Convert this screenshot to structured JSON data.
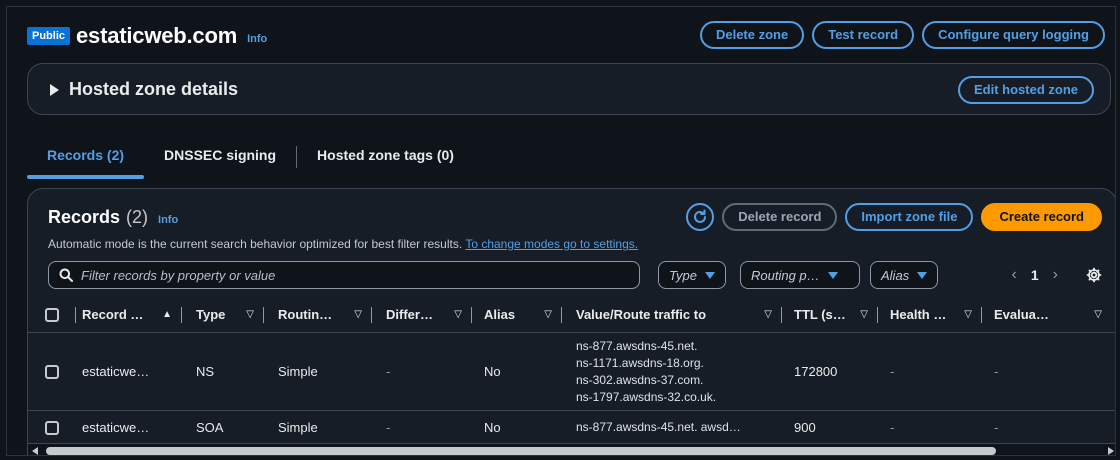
{
  "header": {
    "badge": "Public",
    "title": "estaticweb.com",
    "info": "Info",
    "actions": {
      "delete_zone": "Delete zone",
      "test_record": "Test record",
      "configure_logging": "Configure query logging"
    }
  },
  "details": {
    "title": "Hosted zone details",
    "edit_button": "Edit hosted zone"
  },
  "tabs": [
    {
      "label": "Records (2)",
      "active": true
    },
    {
      "label": "DNSSEC signing",
      "active": false
    },
    {
      "label": "Hosted zone tags (0)",
      "active": false
    }
  ],
  "records": {
    "title": "Records",
    "count": "(2)",
    "info": "Info",
    "delete_button": "Delete record",
    "import_button": "Import zone file",
    "create_button": "Create record",
    "description": "Automatic mode is the current search behavior optimized for best filter results.",
    "settings_link": "To change modes go to settings.",
    "search_placeholder": "Filter records by property or value",
    "filters": {
      "type": "Type",
      "routing": "Routing p…",
      "alias": "Alias"
    },
    "page": "1",
    "columns": [
      "Record …",
      "Type",
      "Routin…",
      "Differ…",
      "Alias",
      "Value/Route traffic to",
      "TTL (s…",
      "Health …",
      "Evalua…"
    ],
    "rows": [
      {
        "name": "estaticwe…",
        "type": "NS",
        "routing": "Simple",
        "differ": "-",
        "alias": "No",
        "values": [
          "ns-877.awsdns-45.net.",
          "ns-1171.awsdns-18.org.",
          "ns-302.awsdns-37.com.",
          "ns-1797.awsdns-32.co.uk."
        ],
        "ttl": "172800",
        "health": "-",
        "evaluate": "-"
      },
      {
        "name": "estaticwe…",
        "type": "SOA",
        "routing": "Simple",
        "differ": "-",
        "alias": "No",
        "values": [
          "ns-877.awsdns-45.net. awsd…"
        ],
        "ttl": "900",
        "health": "-",
        "evaluate": "-"
      }
    ]
  },
  "colors": {
    "background": "#0f141a",
    "panel": "#161d26",
    "link_blue": "#539fe5",
    "primary_orange": "#ff9900",
    "badge_blue": "#0972d3"
  }
}
